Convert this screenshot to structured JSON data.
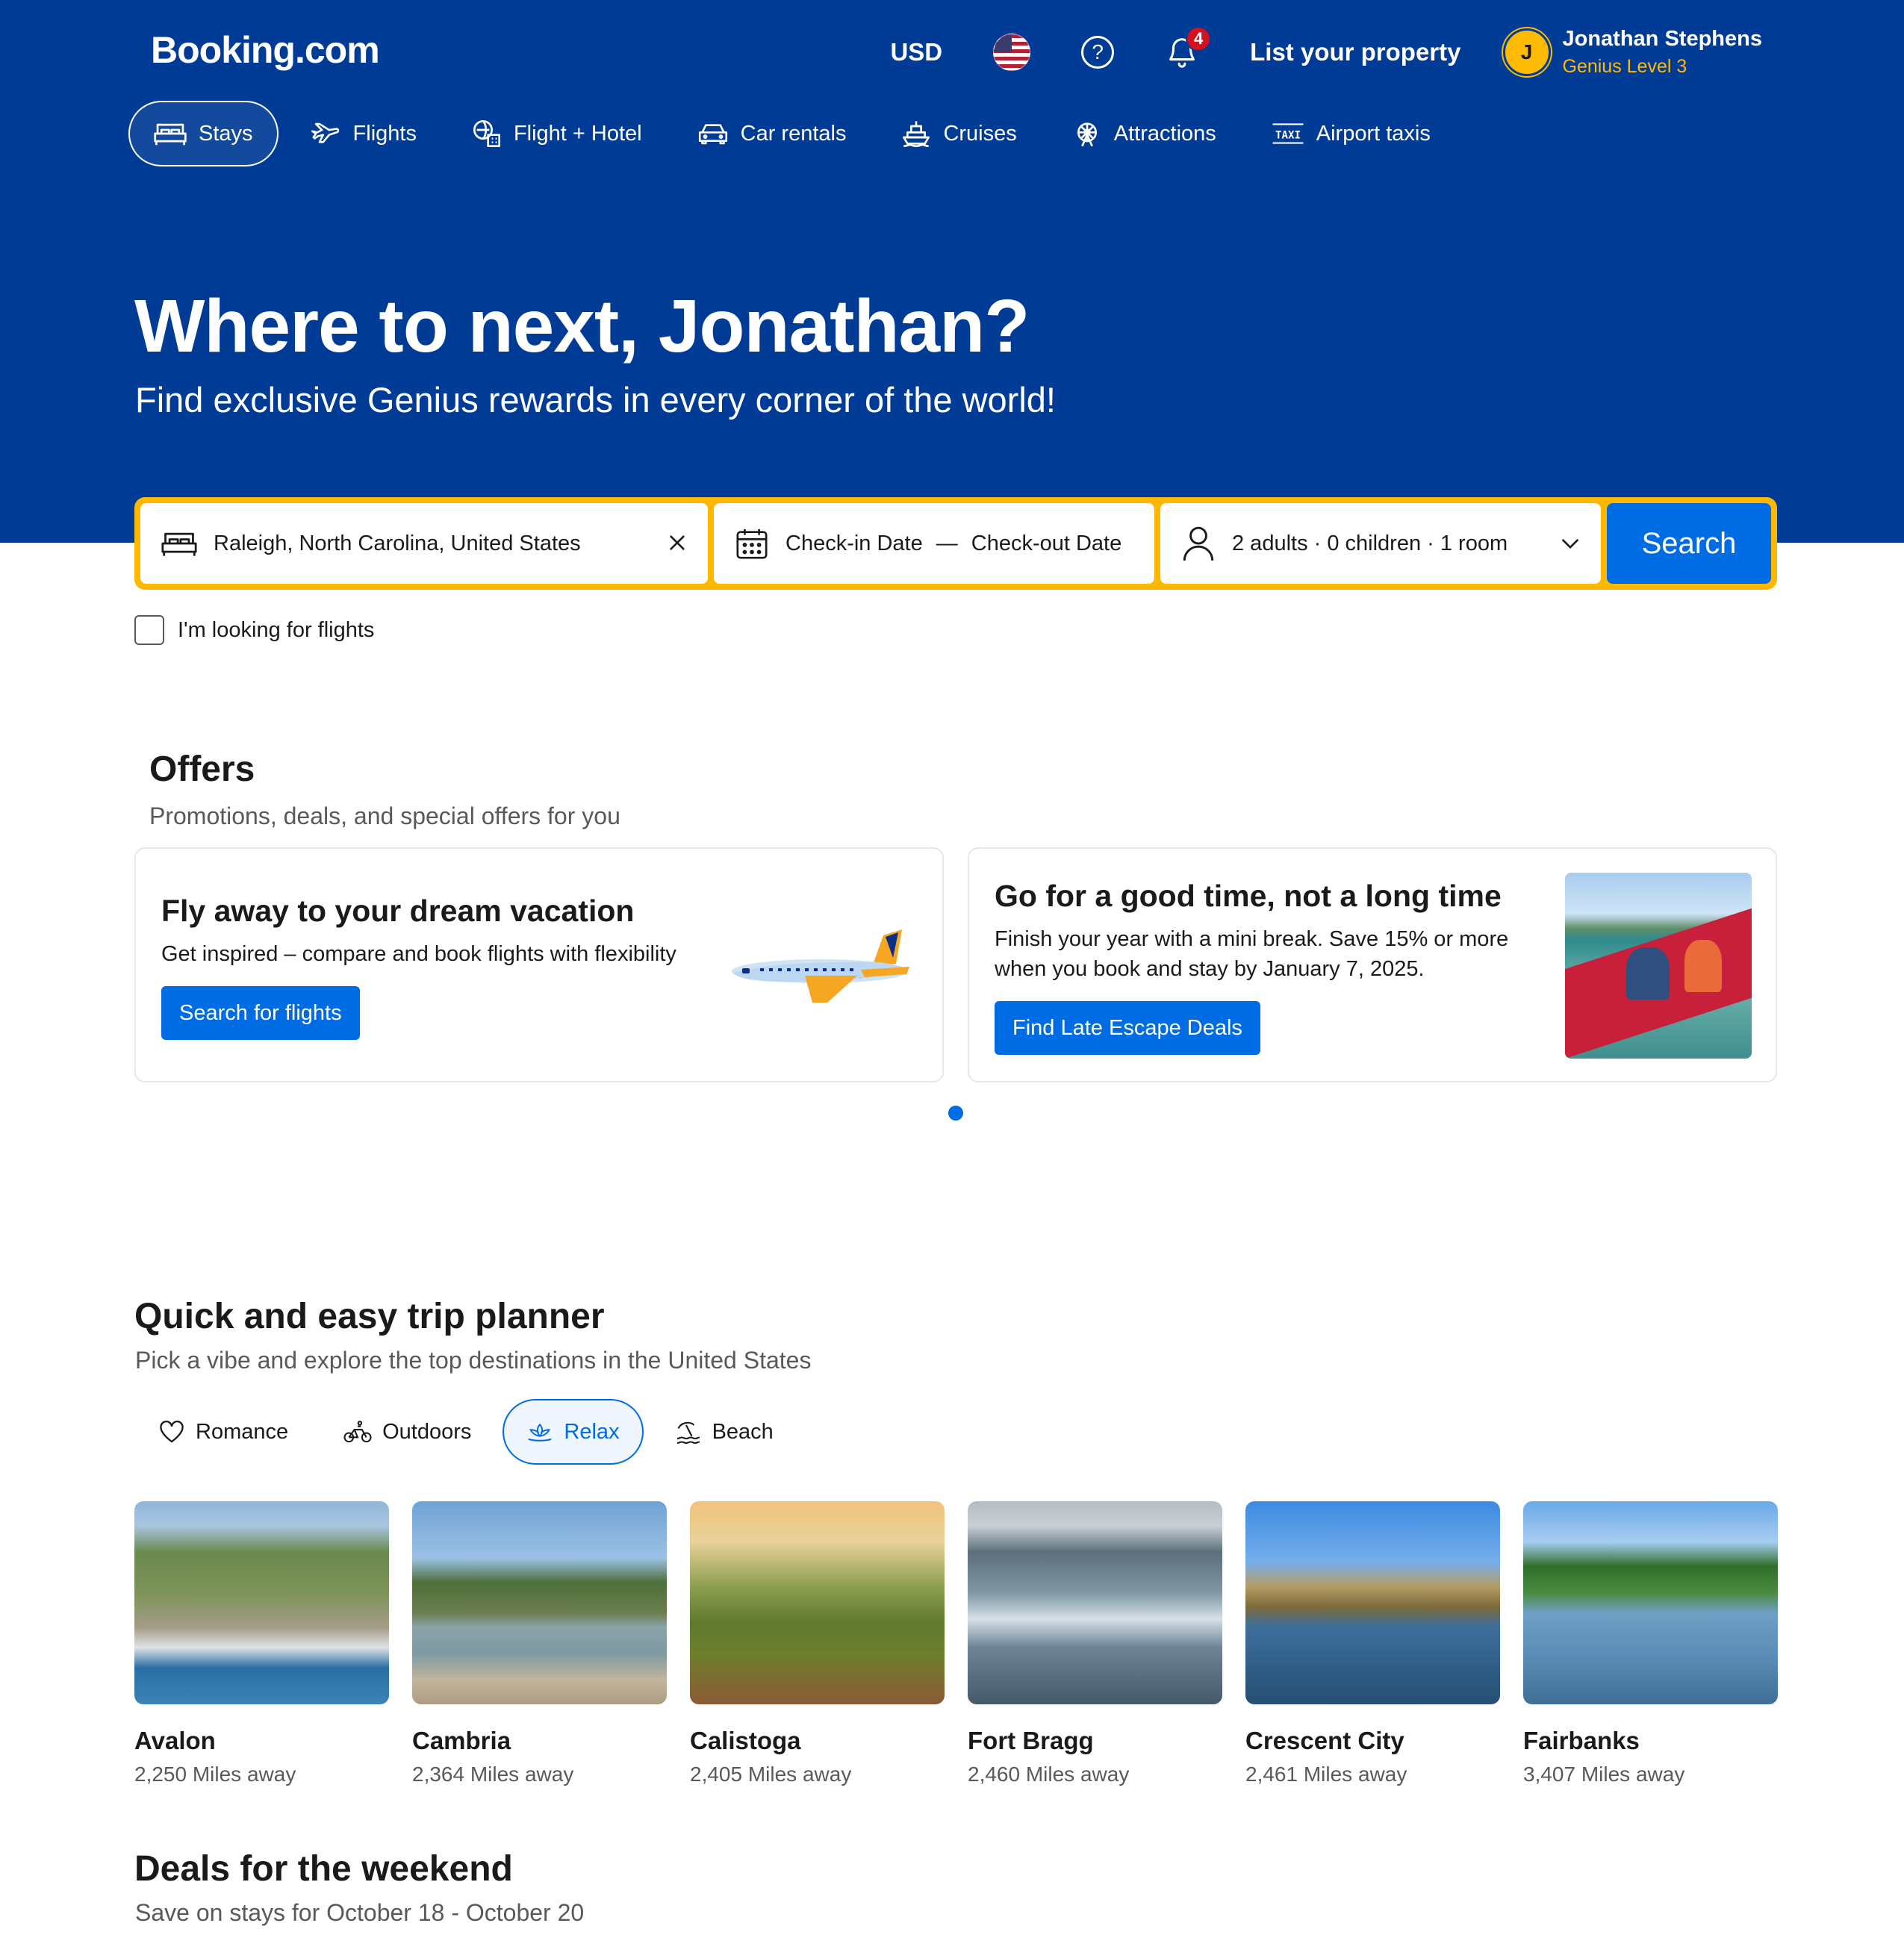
{
  "header": {
    "logo": "Booking.com",
    "currency": "USD",
    "notification_count": "4",
    "list_property": "List your property",
    "user": {
      "initial": "J",
      "name": "Jonathan Stephens",
      "level": "Genius Level 3"
    }
  },
  "nav": {
    "tabs": [
      {
        "label": "Stays",
        "icon": "bed-icon",
        "active": true
      },
      {
        "label": "Flights",
        "icon": "plane-icon"
      },
      {
        "label": "Flight + Hotel",
        "icon": "flight-hotel-icon"
      },
      {
        "label": "Car rentals",
        "icon": "car-icon"
      },
      {
        "label": "Cruises",
        "icon": "ship-icon"
      },
      {
        "label": "Attractions",
        "icon": "ferris-wheel-icon"
      },
      {
        "label": "Airport taxis",
        "icon": "taxi-icon"
      }
    ]
  },
  "hero": {
    "title": "Where to next, Jonathan?",
    "subtitle": "Find exclusive Genius rewards in every corner of the world!"
  },
  "search": {
    "destination": "Raleigh, North Carolina, United States",
    "checkin": "Check-in Date",
    "separator": "—",
    "checkout": "Check-out Date",
    "guests": "2 adults · 0 children · 1 room",
    "button": "Search",
    "flights_checkbox": "I'm looking for flights"
  },
  "offers": {
    "title": "Offers",
    "subtitle": "Promotions, deals, and special offers for you",
    "cards": [
      {
        "title": "Fly away to your dream vacation",
        "text": "Get inspired – compare and book flights with flexibility",
        "button": "Search for flights"
      },
      {
        "title": "Go for a good time, not a long time",
        "text": "Finish your year with a mini break. Save 15% or more when you book and stay by January 7, 2025.",
        "button": "Find Late Escape Deals"
      }
    ]
  },
  "planner": {
    "title": "Quick and easy trip planner",
    "subtitle": "Pick a vibe and explore the top destinations in the United States",
    "vibes": [
      {
        "label": "Romance",
        "icon": "heart-icon"
      },
      {
        "label": "Outdoors",
        "icon": "bicycle-icon"
      },
      {
        "label": "Relax",
        "icon": "lotus-icon",
        "active": true
      },
      {
        "label": "Beach",
        "icon": "beach-icon"
      }
    ],
    "destinations": [
      {
        "name": "Avalon",
        "distance": "2,250 Miles away"
      },
      {
        "name": "Cambria",
        "distance": "2,364 Miles away"
      },
      {
        "name": "Calistoga",
        "distance": "2,405 Miles away"
      },
      {
        "name": "Fort Bragg",
        "distance": "2,460 Miles away"
      },
      {
        "name": "Crescent City",
        "distance": "2,461 Miles away"
      },
      {
        "name": "Fairbanks",
        "distance": "3,407 Miles away"
      }
    ]
  },
  "deals": {
    "title": "Deals for the weekend",
    "subtitle": "Save on stays for October 18 - October 20"
  },
  "colors": {
    "brand_blue": "#003b95",
    "action_blue": "#006ce4",
    "genius_yellow": "#febb02",
    "search_border": "#ffb700"
  }
}
